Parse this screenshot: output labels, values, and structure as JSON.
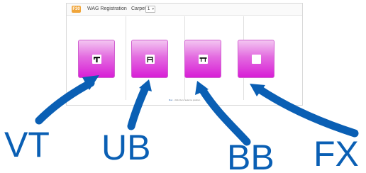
{
  "toolbar": {
    "logo_text": "F30",
    "title": "WAG Registration",
    "carpet_label": "Carpet:",
    "carpet_value": "1"
  },
  "tiles": [
    {
      "id": "vt",
      "icon": "vt-icon"
    },
    {
      "id": "ub",
      "icon": "ub-icon"
    },
    {
      "id": "bb",
      "icon": "bb-icon"
    },
    {
      "id": "fx",
      "icon": "fx-icon"
    }
  ],
  "footer": {
    "link": "Max",
    "text": " · click tile to select a position"
  },
  "annotations": {
    "vt": "VT",
    "ub": "UB",
    "bb": "BB",
    "fx": "FX"
  },
  "colors": {
    "tile_gradient_top": "#f3c6f1",
    "tile_gradient_bottom": "#d81ed6",
    "annotation_blue": "#0a5fb4",
    "logo_orange": "#f0a53a"
  }
}
